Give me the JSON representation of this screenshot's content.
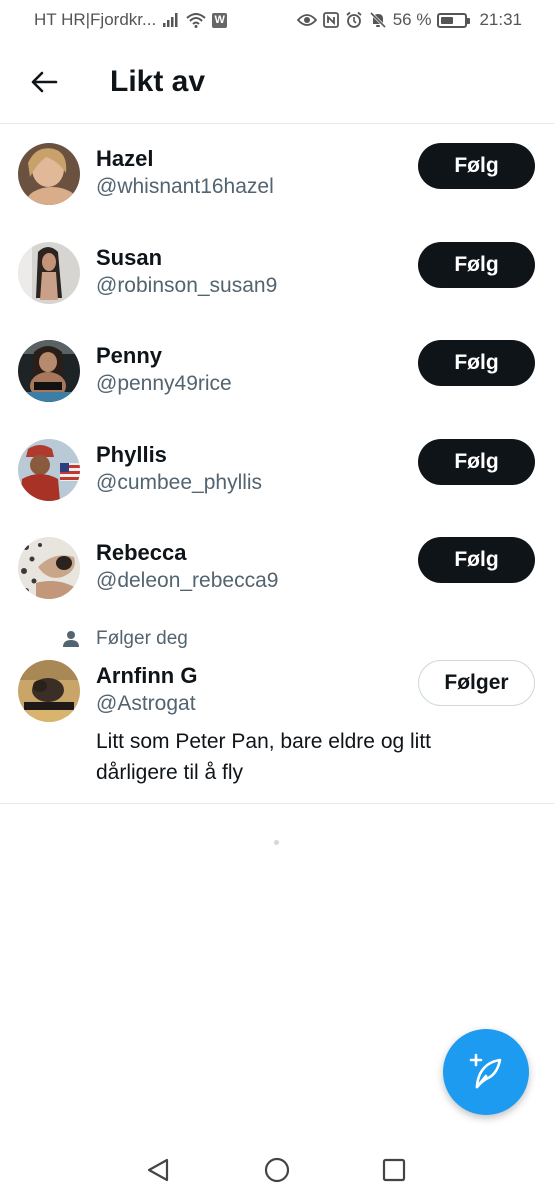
{
  "status_bar": {
    "carrier": "HT HR|Fjordkr...",
    "battery_text": "56 %",
    "battery_level": 0.56,
    "time": "21:31"
  },
  "header": {
    "title": "Likt av"
  },
  "users": [
    {
      "name": "Hazel",
      "handle": "@whisnant16hazel",
      "button": "Følg"
    },
    {
      "name": "Susan",
      "handle": "@robinson_susan9",
      "button": "Følg"
    },
    {
      "name": "Penny",
      "handle": "@penny49rice",
      "button": "Følg"
    },
    {
      "name": "Phyllis",
      "handle": "@cumbee_phyllis",
      "button": "Følg"
    },
    {
      "name": "Rebecca",
      "handle": "@deleon_rebecca9",
      "button": "Følg"
    }
  ],
  "following_user": {
    "context": "Følger deg",
    "name": "Arnfinn G",
    "handle": "@Astrogat",
    "button": "Følger",
    "bio": "Litt som Peter Pan, bare eldre og litt dårligere til å fly"
  },
  "colors": {
    "accent": "#1d9bf0",
    "button_dark": "#0f1419",
    "secondary_text": "#536471"
  }
}
